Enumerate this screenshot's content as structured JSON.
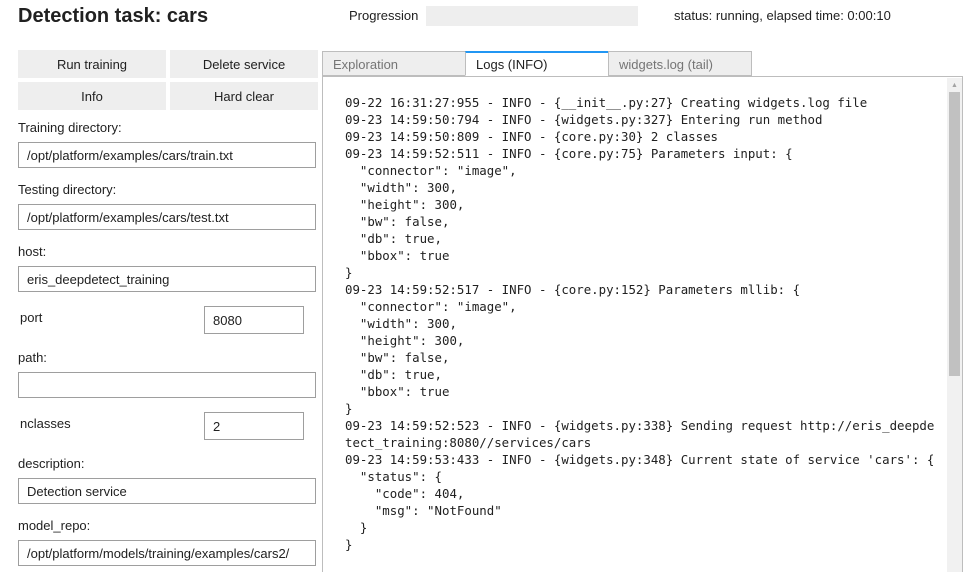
{
  "header": {
    "title": "Detection task: cars",
    "progress_label": "Progression",
    "progress_fraction": 0.0,
    "status_text": "status: running, elapsed time: 0:00:10"
  },
  "buttons": {
    "run_training": "Run training",
    "delete_service": "Delete service",
    "info": "Info",
    "hard_clear": "Hard clear"
  },
  "form": {
    "training_dir_label": "Training directory:",
    "training_dir_value": "/opt/platform/examples/cars/train.txt",
    "testing_dir_label": "Testing directory:",
    "testing_dir_value": "/opt/platform/examples/cars/test.txt",
    "host_label": "host:",
    "host_value": "eris_deepdetect_training",
    "port_label": "port",
    "port_value": "8080",
    "path_label": "path:",
    "path_value": "",
    "nclasses_label": "nclasses",
    "nclasses_value": "2",
    "description_label": "description:",
    "description_value": "Detection service",
    "model_repo_label": "model_repo:",
    "model_repo_value": "/opt/platform/models/training/examples/cars2/"
  },
  "tabs": [
    {
      "label": "Exploration",
      "active": false
    },
    {
      "label": "Logs (INFO)",
      "active": true
    },
    {
      "label": "widgets.log (tail)",
      "active": false
    }
  ],
  "colors": {
    "accent": "#2196f3",
    "button_bg": "#eeeeee"
  },
  "log_lines": [
    "09-22 16:31:27:955 - INFO - {__init__.py:27} Creating widgets.log file",
    "09-23 14:59:50:794 - INFO - {widgets.py:327} Entering run method",
    "09-23 14:59:50:809 - INFO - {core.py:30} 2 classes",
    "09-23 14:59:52:511 - INFO - {core.py:75} Parameters input: {",
    "  \"connector\": \"image\",",
    "  \"width\": 300,",
    "  \"height\": 300,",
    "  \"bw\": false,",
    "  \"db\": true,",
    "  \"bbox\": true",
    "}",
    "09-23 14:59:52:517 - INFO - {core.py:152} Parameters mllib: {",
    "  \"connector\": \"image\",",
    "  \"width\": 300,",
    "  \"height\": 300,",
    "  \"bw\": false,",
    "  \"db\": true,",
    "  \"bbox\": true",
    "}",
    "09-23 14:59:52:523 - INFO - {widgets.py:338} Sending request http://eris_deepdetect_training:8080//services/cars",
    "09-23 14:59:53:433 - INFO - {widgets.py:348} Current state of service 'cars': {",
    "  \"status\": {",
    "    \"code\": 404,",
    "    \"msg\": \"NotFound\"",
    "  }",
    "}"
  ]
}
